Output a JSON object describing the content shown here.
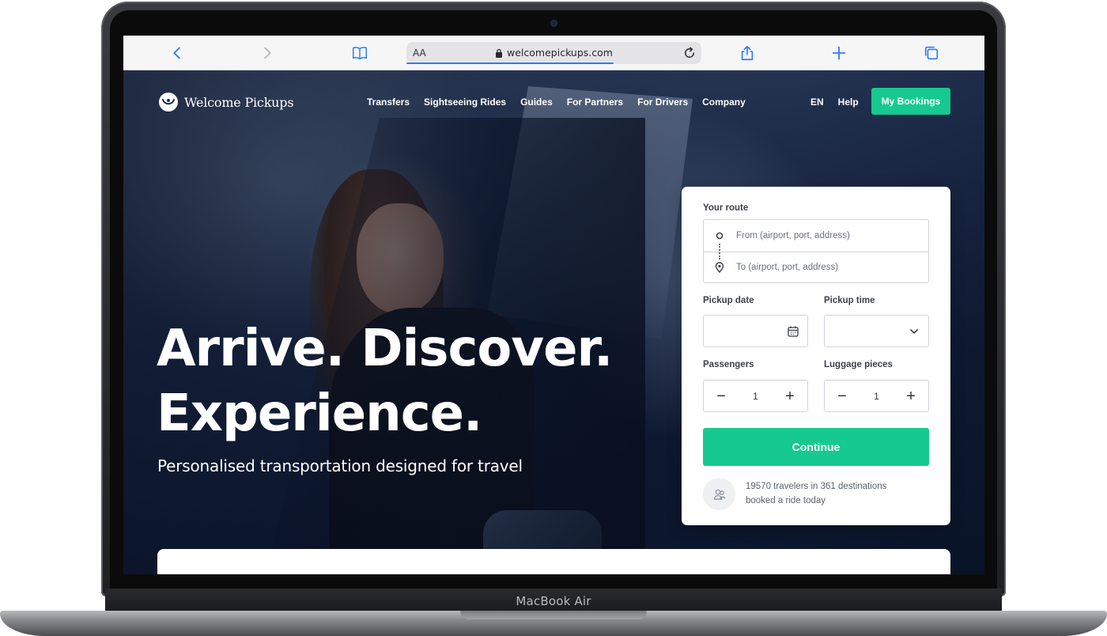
{
  "device": {
    "label": "MacBook Air"
  },
  "browser": {
    "reader_label": "AA",
    "url": "welcomepickups.com",
    "icons": {
      "back": "chevron-left-icon",
      "forward": "chevron-right-icon",
      "bookmarks": "book-icon",
      "lock": "lock-icon",
      "reload": "reload-icon",
      "share": "share-icon",
      "new_tab": "plus-icon",
      "tabs": "tabs-icon"
    },
    "accent": "#2f7bf5"
  },
  "site": {
    "brand": "Welcome Pickups",
    "nav": [
      "Transfers",
      "Sightseeing Rides",
      "Guides",
      "For Partners",
      "For Drivers",
      "Company"
    ],
    "language": "EN",
    "help": "Help",
    "my_bookings": "My Bookings",
    "accent": "#16c98f"
  },
  "hero": {
    "headline_line1": "Arrive. Discover.",
    "headline_line2": "Experience.",
    "subhead": "Personalised transportation designed for travel"
  },
  "booking": {
    "route_label": "Your route",
    "from_placeholder": "From (airport, port, address)",
    "to_placeholder": "To (airport, port, address)",
    "pickup_date_label": "Pickup date",
    "pickup_time_label": "Pickup time",
    "passengers_label": "Passengers",
    "passengers_value": "1",
    "luggage_label": "Luggage pieces",
    "luggage_value": "1",
    "continue": "Continue",
    "stat_line1": "19570 travelers in 361 destinations",
    "stat_line2": "booked a ride today"
  }
}
